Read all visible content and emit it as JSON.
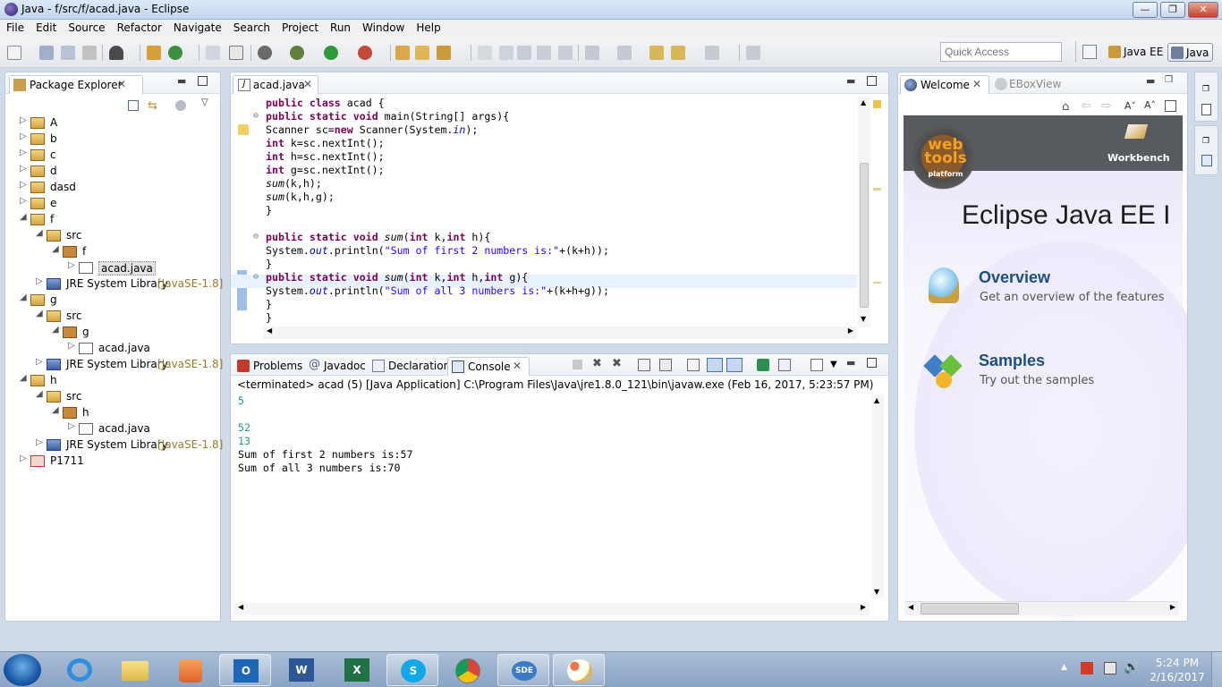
{
  "window": {
    "title": "Java - f/src/f/acad.java - Eclipse"
  },
  "menu": [
    "File",
    "Edit",
    "Source",
    "Refactor",
    "Navigate",
    "Search",
    "Project",
    "Run",
    "Window",
    "Help"
  ],
  "toolbar": {
    "quick_access_placeholder": "Quick Access",
    "perspectives": [
      "Java EE",
      "Java"
    ]
  },
  "package_explorer": {
    "title": "Package Explorer",
    "rows": [
      {
        "label": "A"
      },
      {
        "label": "b"
      },
      {
        "label": "c"
      },
      {
        "label": "d"
      },
      {
        "label": "dasd"
      },
      {
        "label": "e"
      },
      {
        "label": "f"
      },
      {
        "label": "src"
      },
      {
        "label": "f"
      },
      {
        "label": "acad.java"
      },
      {
        "label": "JRE System Library",
        "deco": "[JavaSE-1.8]"
      },
      {
        "label": "g"
      },
      {
        "label": "src"
      },
      {
        "label": "g"
      },
      {
        "label": "acad.java"
      },
      {
        "label": "JRE System Library",
        "deco": "[JavaSE-1.8]"
      },
      {
        "label": "h"
      },
      {
        "label": "src"
      },
      {
        "label": "h"
      },
      {
        "label": "acad.java"
      },
      {
        "label": "JRE System Library",
        "deco": "[JavaSE-1.8]"
      },
      {
        "label": "P1711"
      }
    ]
  },
  "editor": {
    "tab": "acad.java",
    "lines": [
      "public class acad {",
      "public static void main(String[] args){",
      "Scanner sc=new Scanner(System.in);",
      "int k=sc.nextInt();",
      "int h=sc.nextInt();",
      "int g=sc.nextInt();",
      "sum(k,h);",
      "sum(k,h,g);",
      "}",
      "",
      "public static void sum(int k,int h){",
      "System.out.println(\"Sum of first 2 numbers is:\"+(k+h));",
      "}",
      "public static void sum(int k,int h,int g){",
      "System.out.println(\"Sum of all 3 numbers is:\"+(k+h+g));",
      "}",
      "}"
    ]
  },
  "bottom": {
    "tabs": [
      "Problems",
      "Javadoc",
      "Declaration",
      "Console"
    ],
    "active_tab": "Console",
    "status": "<terminated> acad (5) [Java Application] C:\\Program Files\\Java\\jre1.8.0_121\\bin\\javaw.exe (Feb 16, 2017, 5:23:57 PM)",
    "output": [
      "5",
      "",
      "52",
      "13",
      "Sum of first 2 numbers is:57",
      "Sum of all 3 numbers is:70"
    ]
  },
  "welcome": {
    "tabs": [
      "Welcome",
      "EBoxView"
    ],
    "logo_text": [
      "web",
      "tools",
      "platform"
    ],
    "workbench": "Workbench",
    "heading": "Eclipse Java EE I",
    "items": [
      {
        "title": "Overview",
        "desc": "Get an overview of the features"
      },
      {
        "title": "Samples",
        "desc": "Try out the samples"
      }
    ]
  },
  "taskbar": {
    "time": "5:24 PM",
    "date": "2/16/2017",
    "sde_label": "SDE"
  }
}
